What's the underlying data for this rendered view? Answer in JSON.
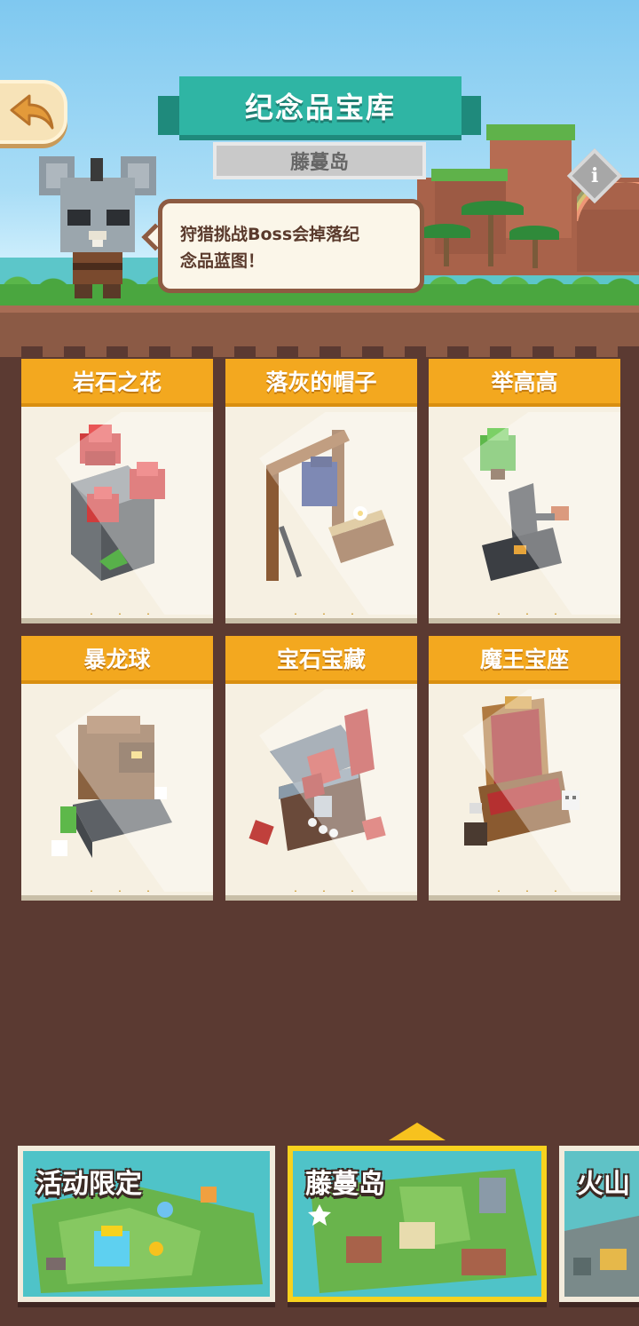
{
  "header": {
    "title": "纪念品宝库",
    "subtitle": "藤蔓岛",
    "hint": [
      "狩猎挑战Boss会掉落纪",
      "念品蓝图！"
    ]
  },
  "cards": [
    {
      "name": "岩石之花",
      "stars": 3,
      "icon": "rock-flower-icon"
    },
    {
      "name": "落灰的帽子",
      "stars": 3,
      "icon": "dusty-hat-icon"
    },
    {
      "name": "举高高",
      "stars": 3,
      "icon": "lift-high-icon"
    },
    {
      "name": "暴龙球",
      "stars": 3,
      "icon": "tyrant-ball-icon"
    },
    {
      "name": "宝石宝藏",
      "stars": 3,
      "icon": "gem-treasure-icon"
    },
    {
      "name": "魔王宝座",
      "stars": 3,
      "icon": "demon-throne-icon"
    }
  ],
  "maps": [
    {
      "label": "活动限定",
      "active": false
    },
    {
      "label": "藤蔓岛",
      "active": true
    },
    {
      "label": "火山",
      "active": false
    }
  ],
  "colors": {
    "background": "#5b3a32",
    "card_header": "#f3a81f",
    "banner": "#2fb5a4",
    "star": "#f7c21e",
    "selected_border": "#f7d21e"
  }
}
